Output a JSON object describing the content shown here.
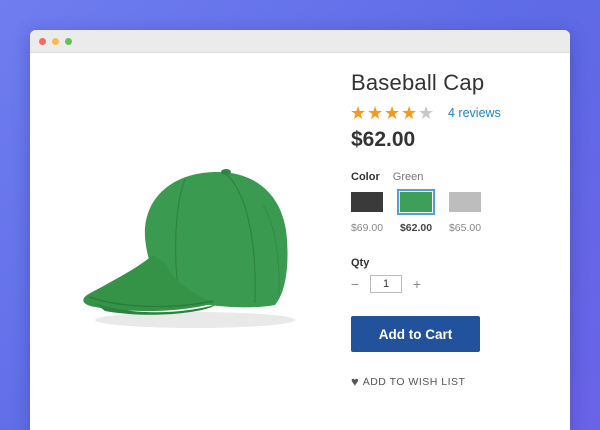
{
  "product": {
    "title": "Baseball Cap",
    "rating": 4,
    "rating_max": 5,
    "reviews_label": "4 reviews",
    "price": "$62.00",
    "image_icon": "baseball-cap-image",
    "cap_color": "#3a9a50"
  },
  "color": {
    "label": "Color",
    "selected": "Green",
    "options": [
      {
        "name": "black",
        "hex": "#3a3a3a",
        "price": "$69.00"
      },
      {
        "name": "green",
        "hex": "#3f9e57",
        "price": "$62.00"
      },
      {
        "name": "gray",
        "hex": "#bdbdbd",
        "price": "$65.00"
      }
    ]
  },
  "qty": {
    "label": "Qty",
    "value": "1",
    "minus": "−",
    "plus": "+"
  },
  "actions": {
    "add_to_cart": "Add to Cart",
    "wish_list": "ADD TO WISH LIST",
    "accent": "#23529d"
  }
}
